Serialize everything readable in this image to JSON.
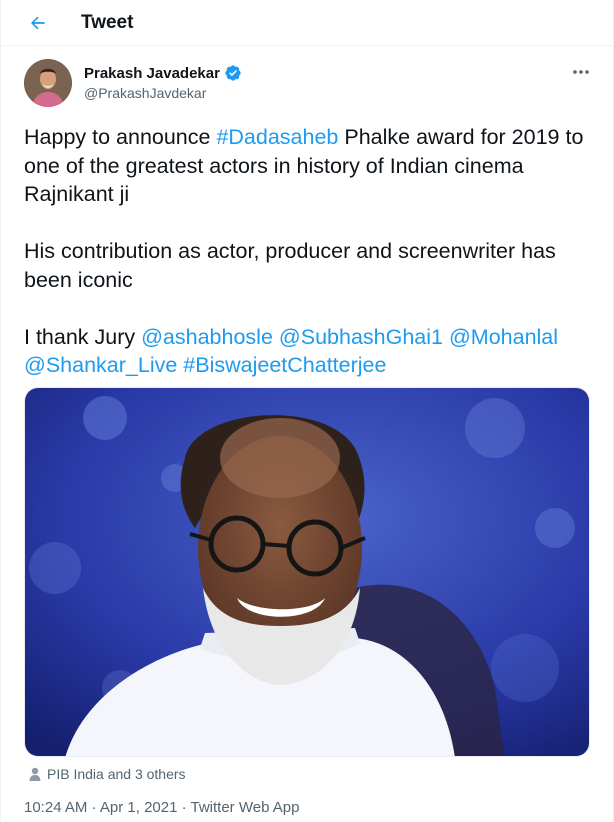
{
  "header": {
    "title": "Tweet",
    "back_icon": "arrow-left-icon"
  },
  "author": {
    "name": "Prakash Javadekar",
    "handle": "@PrakashJavdekar",
    "verified": true,
    "verified_icon": "verified-badge-icon"
  },
  "tweet": {
    "line1_pre": "Happy to announce ",
    "line1_hashtag": "#Dadasaheb",
    "line1_post": " Phalke award for 2019 to one of the greatest actors in history of Indian cinema Rajnikant ji",
    "paragraph2": "His contribution as actor, producer and screenwriter has been iconic",
    "para3_pre": "I thank Jury ",
    "mentions": [
      "@ashabhosle",
      "@SubhashGhai1",
      "@Mohanlal",
      "@Shankar_Live",
      "#BiswajeetChatterjee"
    ]
  },
  "likes": {
    "icon": "person-icon",
    "text": "PIB India and 3 others"
  },
  "meta": {
    "text": "10:24 AM · Apr 1, 2021 · Twitter Web App"
  },
  "colors": {
    "accent": "#1d9bf0",
    "text_primary": "#0f1419",
    "text_secondary": "#536471"
  }
}
